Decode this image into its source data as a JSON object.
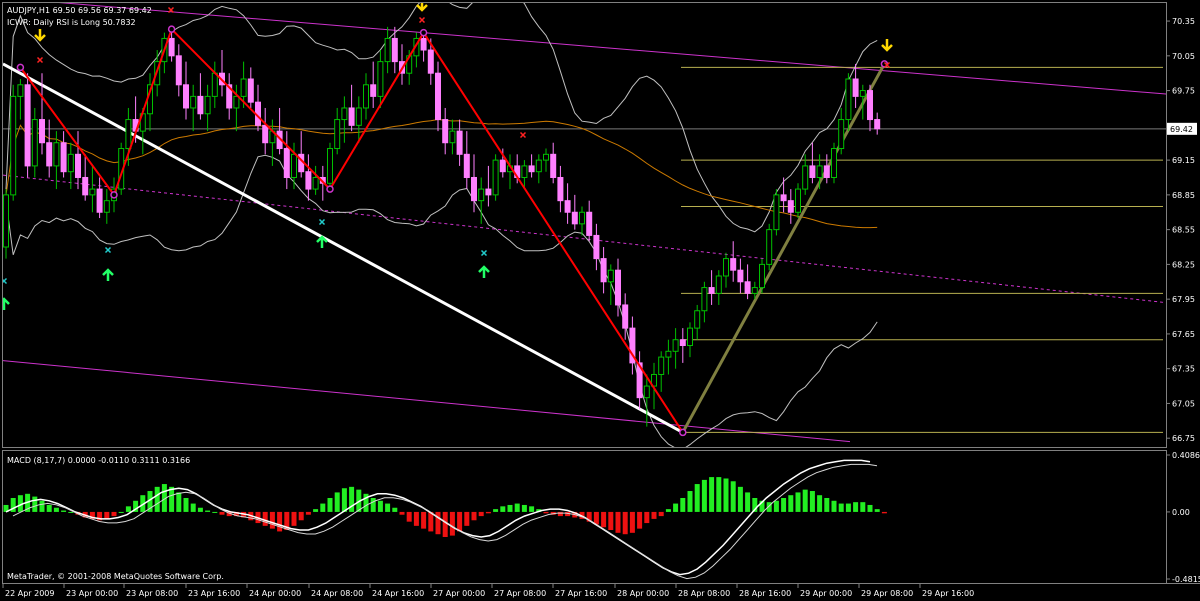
{
  "header": {
    "symbol_line": "AUDJPY,H1  69.50 69.56 69.37 69.42",
    "indicator_line": "ICWR: Daily RSI is Long 50.7832"
  },
  "macd": {
    "label": "MACD (8,17,7) 0.0000 -0.0110 0.3111 0.3166"
  },
  "footer": {
    "copyright": "MetaTrader, © 2001-2008 MetaQuotes Software Corp."
  },
  "colors": {
    "background": "#000000",
    "bull_candle": "#00c000",
    "bear_candle": "#ff80ff",
    "wave": "#ff0000",
    "trend_white": "#ffffff",
    "channel": "#cc33cc",
    "bollinger": "#c0c0c0",
    "ma_orange": "#cc7a00",
    "fib": "#b8b050",
    "olive_line": "#808040",
    "macd_pos": "#22ee22",
    "macd_neg": "#ee1111"
  },
  "chart_data": [
    {
      "type": "candlestick",
      "title": "AUDJPY,H1",
      "ohlc_last": {
        "open": 69.5,
        "high": 69.56,
        "low": 69.37,
        "close": 69.42
      },
      "current_price_label": "69.42",
      "y_tick_labels": [
        "70.35",
        "70.05",
        "69.75",
        "69.42",
        "69.15",
        "68.85",
        "68.55",
        "68.25",
        "67.95",
        "67.65",
        "67.35",
        "67.05",
        "66.75"
      ],
      "ylim": [
        66.7,
        70.48
      ],
      "x_tick_labels": [
        "22 Apr 2009",
        "23 Apr 00:00",
        "23 Apr 08:00",
        "23 Apr 16:00",
        "24 Apr 00:00",
        "24 Apr 08:00",
        "24 Apr 16:00",
        "27 Apr 00:00",
        "27 Apr 08:00",
        "27 Apr 16:00",
        "28 Apr 00:00",
        "28 Apr 08:00",
        "28 Apr 16:00",
        "29 Apr 00:00",
        "29 Apr 08:00",
        "29 Apr 16:00"
      ],
      "fib_levels": [
        69.95,
        69.15,
        68.75,
        68.0,
        67.6,
        66.8
      ],
      "zigzag": [
        {
          "bar": 2,
          "price": 69.95
        },
        {
          "bar": 15,
          "price": 68.85
        },
        {
          "bar": 23,
          "price": 70.28
        },
        {
          "bar": 45,
          "price": 68.9
        },
        {
          "bar": 58,
          "price": 70.25
        },
        {
          "bar": 94,
          "price": 66.8
        },
        {
          "bar": 122,
          "price": 69.98
        }
      ],
      "candles": [
        [
          68.4,
          68.9,
          68.3,
          68.85
        ],
        [
          68.85,
          69.8,
          68.8,
          69.7
        ],
        [
          69.7,
          69.85,
          69.5,
          69.8
        ],
        [
          69.8,
          69.9,
          69.0,
          69.1
        ],
        [
          69.1,
          69.6,
          69.0,
          69.5
        ],
        [
          69.5,
          69.9,
          69.2,
          69.3
        ],
        [
          69.3,
          69.5,
          69.0,
          69.1
        ],
        [
          69.1,
          69.4,
          68.9,
          69.3
        ],
        [
          69.3,
          69.4,
          69.0,
          69.05
        ],
        [
          69.05,
          69.3,
          68.9,
          69.2
        ],
        [
          69.2,
          69.4,
          68.9,
          69.0
        ],
        [
          69.0,
          69.2,
          68.8,
          68.85
        ],
        [
          68.85,
          69.1,
          68.7,
          68.9
        ],
        [
          68.9,
          69.0,
          68.65,
          68.7
        ],
        [
          68.7,
          68.9,
          68.6,
          68.8
        ],
        [
          68.8,
          69.0,
          68.7,
          68.9
        ],
        [
          68.9,
          69.3,
          68.85,
          69.25
        ],
        [
          69.25,
          69.6,
          69.1,
          69.5
        ],
        [
          69.5,
          69.7,
          69.3,
          69.4
        ],
        [
          69.4,
          69.6,
          69.2,
          69.55
        ],
        [
          69.55,
          69.9,
          69.4,
          69.8
        ],
        [
          69.8,
          70.1,
          69.7,
          70.0
        ],
        [
          70.0,
          70.25,
          69.9,
          70.2
        ],
        [
          70.2,
          70.3,
          70.0,
          70.05
        ],
        [
          70.05,
          70.15,
          69.7,
          69.8
        ],
        [
          69.8,
          70.0,
          69.5,
          69.6
        ],
        [
          69.6,
          69.8,
          69.4,
          69.7
        ],
        [
          69.7,
          69.9,
          69.5,
          69.55
        ],
        [
          69.55,
          69.8,
          69.4,
          69.7
        ],
        [
          69.7,
          70.0,
          69.6,
          69.9
        ],
        [
          69.9,
          70.1,
          69.7,
          69.8
        ],
        [
          69.8,
          69.9,
          69.5,
          69.6
        ],
        [
          69.6,
          69.8,
          69.4,
          69.7
        ],
        [
          69.7,
          70.0,
          69.6,
          69.85
        ],
        [
          69.85,
          69.95,
          69.6,
          69.65
        ],
        [
          69.65,
          69.8,
          69.4,
          69.45
        ],
        [
          69.45,
          69.6,
          69.2,
          69.3
        ],
        [
          69.3,
          69.5,
          69.1,
          69.4
        ],
        [
          69.4,
          69.6,
          69.2,
          69.25
        ],
        [
          69.25,
          69.4,
          68.9,
          69.0
        ],
        [
          69.0,
          69.3,
          68.9,
          69.2
        ],
        [
          69.2,
          69.4,
          69.0,
          69.05
        ],
        [
          69.05,
          69.2,
          68.8,
          68.9
        ],
        [
          68.9,
          69.1,
          68.85,
          69.0
        ],
        [
          69.0,
          69.1,
          68.8,
          68.95
        ],
        [
          68.95,
          69.3,
          68.9,
          69.25
        ],
        [
          69.25,
          69.6,
          69.2,
          69.5
        ],
        [
          69.5,
          69.7,
          69.3,
          69.6
        ],
        [
          69.6,
          69.8,
          69.4,
          69.45
        ],
        [
          69.45,
          69.7,
          69.3,
          69.6
        ],
        [
          69.6,
          69.9,
          69.5,
          69.8
        ],
        [
          69.8,
          70.0,
          69.6,
          69.7
        ],
        [
          69.7,
          70.1,
          69.6,
          70.0
        ],
        [
          70.0,
          70.3,
          69.9,
          70.2
        ],
        [
          70.2,
          70.3,
          69.9,
          70.0
        ],
        [
          70.0,
          70.15,
          69.8,
          69.9
        ],
        [
          69.9,
          70.1,
          69.8,
          70.05
        ],
        [
          70.05,
          70.25,
          69.95,
          70.2
        ],
        [
          70.2,
          70.28,
          70.0,
          70.1
        ],
        [
          70.1,
          70.2,
          69.8,
          69.9
        ],
        [
          69.9,
          70.0,
          69.4,
          69.5
        ],
        [
          69.5,
          69.6,
          69.2,
          69.3
        ],
        [
          69.3,
          69.5,
          69.2,
          69.4
        ],
        [
          69.4,
          69.5,
          69.1,
          69.2
        ],
        [
          69.2,
          69.4,
          68.9,
          69.0
        ],
        [
          69.0,
          69.2,
          68.7,
          68.8
        ],
        [
          68.8,
          69.0,
          68.6,
          68.9
        ],
        [
          68.9,
          69.1,
          68.75,
          68.85
        ],
        [
          68.85,
          69.2,
          68.8,
          69.15
        ],
        [
          69.15,
          69.25,
          69.0,
          69.05
        ],
        [
          69.05,
          69.2,
          68.9,
          69.1
        ],
        [
          69.1,
          69.2,
          68.95,
          69.0
        ],
        [
          69.0,
          69.15,
          68.9,
          69.1
        ],
        [
          69.1,
          69.2,
          69.0,
          69.05
        ],
        [
          69.05,
          69.2,
          68.95,
          69.15
        ],
        [
          69.15,
          69.25,
          69.05,
          69.2
        ],
        [
          69.2,
          69.3,
          68.95,
          69.0
        ],
        [
          69.0,
          69.1,
          68.7,
          68.8
        ],
        [
          68.8,
          68.95,
          68.6,
          68.7
        ],
        [
          68.7,
          68.85,
          68.55,
          68.6
        ],
        [
          68.6,
          68.75,
          68.5,
          68.7
        ],
        [
          68.7,
          68.8,
          68.45,
          68.5
        ],
        [
          68.5,
          68.6,
          68.2,
          68.3
        ],
        [
          68.3,
          68.4,
          68.0,
          68.1
        ],
        [
          68.1,
          68.25,
          67.9,
          68.2
        ],
        [
          68.2,
          68.3,
          67.8,
          67.9
        ],
        [
          67.9,
          68.0,
          67.6,
          67.7
        ],
        [
          67.7,
          67.8,
          67.3,
          67.4
        ],
        [
          67.4,
          67.5,
          67.0,
          67.1
        ],
        [
          67.1,
          67.3,
          66.85,
          67.2
        ],
        [
          67.2,
          67.4,
          67.0,
          67.3
        ],
        [
          67.3,
          67.5,
          67.15,
          67.45
        ],
        [
          67.45,
          67.6,
          67.3,
          67.5
        ],
        [
          67.5,
          67.7,
          67.35,
          67.6
        ],
        [
          67.6,
          67.7,
          67.4,
          67.55
        ],
        [
          67.55,
          67.75,
          67.45,
          67.7
        ],
        [
          67.7,
          67.9,
          67.6,
          67.85
        ],
        [
          67.85,
          68.1,
          67.75,
          68.05
        ],
        [
          68.05,
          68.2,
          67.9,
          68.0
        ],
        [
          68.0,
          68.2,
          67.9,
          68.15
        ],
        [
          68.15,
          68.35,
          68.05,
          68.3
        ],
        [
          68.3,
          68.45,
          68.1,
          68.2
        ],
        [
          68.2,
          68.3,
          68.0,
          68.1
        ],
        [
          68.1,
          68.25,
          67.95,
          68.0
        ],
        [
          68.0,
          68.1,
          67.95,
          68.05
        ],
        [
          68.05,
          68.3,
          68.0,
          68.25
        ],
        [
          68.25,
          68.6,
          68.2,
          68.55
        ],
        [
          68.55,
          68.9,
          68.5,
          68.85
        ],
        [
          68.85,
          69.0,
          68.7,
          68.8
        ],
        [
          68.8,
          68.9,
          68.6,
          68.7
        ],
        [
          68.7,
          68.95,
          68.65,
          68.9
        ],
        [
          68.9,
          69.2,
          68.85,
          69.1
        ],
        [
          69.1,
          69.3,
          68.95,
          69.0
        ],
        [
          69.0,
          69.2,
          68.9,
          69.1
        ],
        [
          69.1,
          69.2,
          68.95,
          69.0
        ],
        [
          69.0,
          69.3,
          68.95,
          69.25
        ],
        [
          69.25,
          69.6,
          69.2,
          69.5
        ],
        [
          69.5,
          69.9,
          69.4,
          69.85
        ],
        [
          69.85,
          69.98,
          69.6,
          69.7
        ],
        [
          69.7,
          69.8,
          69.5,
          69.75
        ],
        [
          69.75,
          69.8,
          69.4,
          69.5
        ],
        [
          69.5,
          69.56,
          69.37,
          69.42
        ]
      ]
    },
    {
      "type": "bar",
      "title": "MACD (8,17,7)",
      "parameters": "8,17,7",
      "values_shown": [
        0.0,
        -0.011,
        0.3111,
        0.3166
      ],
      "y_tick_labels": [
        "0.4086",
        "0.00",
        "-0.4815"
      ],
      "ylim": [
        -0.4815,
        0.4086
      ],
      "histogram": [
        0.05,
        0.1,
        0.12,
        0.13,
        0.11,
        0.08,
        0.05,
        0.03,
        0.01,
        0.0,
        -0.02,
        -0.04,
        -0.05,
        -0.06,
        -0.05,
        -0.03,
        0.0,
        0.04,
        0.08,
        0.12,
        0.15,
        0.18,
        0.2,
        0.18,
        0.14,
        0.1,
        0.06,
        0.03,
        0.01,
        0.0,
        -0.02,
        -0.03,
        -0.03,
        -0.04,
        -0.06,
        -0.08,
        -0.1,
        -0.12,
        -0.14,
        -0.13,
        -0.1,
        -0.06,
        -0.02,
        0.02,
        0.06,
        0.1,
        0.14,
        0.17,
        0.18,
        0.16,
        0.13,
        0.1,
        0.08,
        0.06,
        0.03,
        -0.02,
        -0.07,
        -0.1,
        -0.12,
        -0.14,
        -0.16,
        -0.18,
        -0.17,
        -0.14,
        -0.1,
        -0.06,
        -0.03,
        -0.01,
        0.02,
        0.04,
        0.05,
        0.06,
        0.05,
        0.04,
        0.02,
        -0.01,
        -0.02,
        -0.03,
        -0.03,
        -0.04,
        -0.05,
        -0.07,
        -0.09,
        -0.11,
        -0.13,
        -0.15,
        -0.16,
        -0.15,
        -0.12,
        -0.08,
        -0.05,
        -0.03,
        0.02,
        0.06,
        0.1,
        0.15,
        0.2,
        0.23,
        0.25,
        0.25,
        0.24,
        0.22,
        0.18,
        0.14,
        0.1,
        0.08,
        0.07,
        0.08,
        0.1,
        0.12,
        0.14,
        0.16,
        0.15,
        0.12,
        0.1,
        0.08,
        0.06,
        0.06,
        0.07,
        0.07,
        0.05,
        0.02,
        -0.01
      ],
      "signal": [
        0.0,
        0.03,
        0.06,
        0.08,
        0.09,
        0.08,
        0.06,
        0.03,
        0.0,
        -0.02,
        -0.04,
        -0.05,
        -0.05,
        -0.04,
        -0.02,
        0.02,
        0.06,
        0.1,
        0.14,
        0.16,
        0.17,
        0.16,
        0.13,
        0.09,
        0.05,
        0.02,
        0.0,
        -0.01,
        -0.02,
        -0.04,
        -0.06,
        -0.08,
        -0.1,
        -0.12,
        -0.13,
        -0.13,
        -0.11,
        -0.08,
        -0.04,
        0.0,
        0.04,
        0.08,
        0.11,
        0.13,
        0.13,
        0.12,
        0.1,
        0.07,
        0.04,
        0.0,
        -0.04,
        -0.08,
        -0.12,
        -0.15,
        -0.17,
        -0.18,
        -0.17,
        -0.14,
        -0.1,
        -0.06,
        -0.03,
        -0.01,
        0.01,
        0.02,
        0.02,
        0.01,
        -0.01,
        -0.04,
        -0.08,
        -0.12,
        -0.16,
        -0.2,
        -0.24,
        -0.28,
        -0.32,
        -0.36,
        -0.4,
        -0.43,
        -0.45,
        -0.44,
        -0.41,
        -0.36,
        -0.3,
        -0.24,
        -0.17,
        -0.1,
        -0.03,
        0.04,
        0.1,
        0.15,
        0.2,
        0.24,
        0.28,
        0.31,
        0.33,
        0.35,
        0.36,
        0.37,
        0.37,
        0.37,
        0.36
      ]
    }
  ]
}
